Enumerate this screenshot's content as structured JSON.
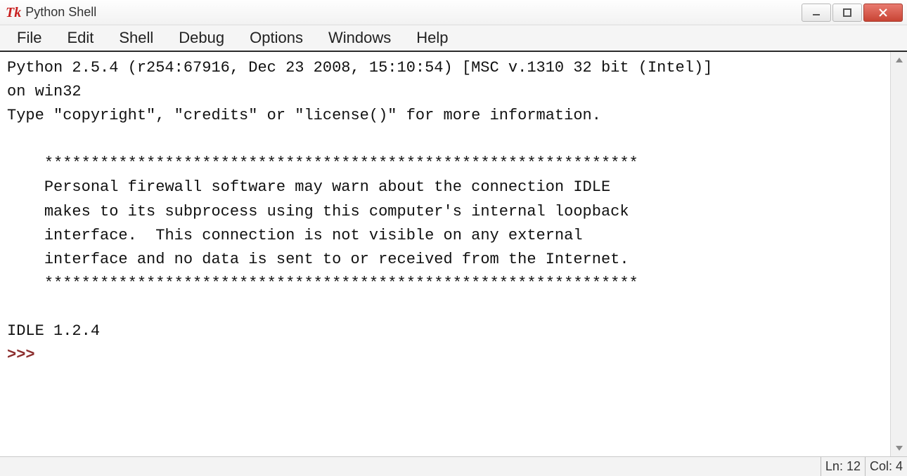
{
  "window": {
    "title": "Python Shell",
    "icon_label": "Tk"
  },
  "menubar": {
    "items": [
      "File",
      "Edit",
      "Shell",
      "Debug",
      "Options",
      "Windows",
      "Help"
    ]
  },
  "shell": {
    "line1": "Python 2.5.4 (r254:67916, Dec 23 2008, 15:10:54) [MSC v.1310 32 bit (Intel)]",
    "line2": "on win32",
    "line3": "Type \"copyright\", \"credits\" or \"license()\" for more information.",
    "blank1": "",
    "rule1": "    ****************************************************************",
    "fw1": "    Personal firewall software may warn about the connection IDLE",
    "fw2": "    makes to its subprocess using this computer's internal loopback",
    "fw3": "    interface.  This connection is not visible on any external",
    "fw4": "    interface and no data is sent to or received from the Internet.",
    "rule2": "    ****************************************************************",
    "blank2": "",
    "idle": "IDLE 1.2.4",
    "prompt": ">>> "
  },
  "status": {
    "line_label": "Ln: 12",
    "col_label": "Col: 4"
  }
}
